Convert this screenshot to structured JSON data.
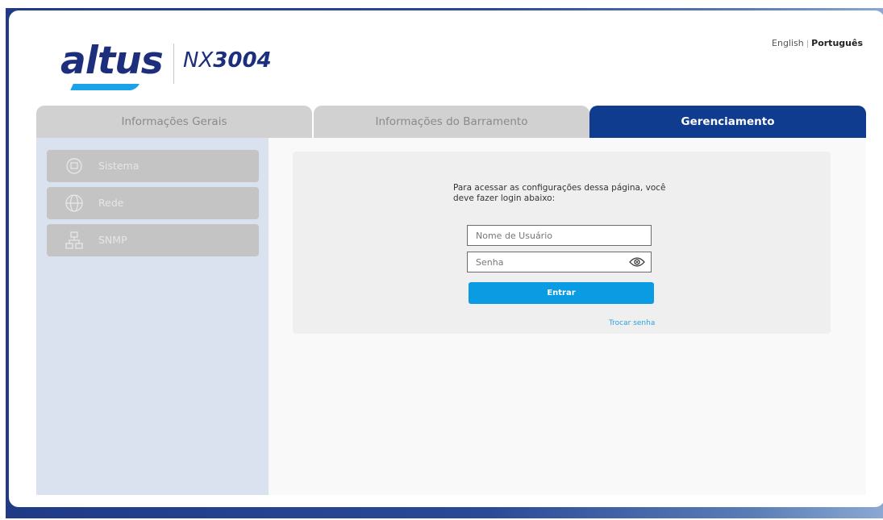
{
  "header": {
    "logo_text": "altus",
    "model_prefix": "NX",
    "model_number": "3004",
    "lang_english": "English",
    "lang_separator": "|",
    "lang_portuguese": "Português"
  },
  "tabs": [
    {
      "label": "Informações Gerais",
      "active": false
    },
    {
      "label": "Informações do Barramento",
      "active": false
    },
    {
      "label": "Gerenciamento",
      "active": true
    }
  ],
  "sidebar": {
    "items": [
      {
        "label": "Sistema",
        "icon": "system-icon"
      },
      {
        "label": "Rede",
        "icon": "globe-icon"
      },
      {
        "label": "SNMP",
        "icon": "network-icon"
      }
    ]
  },
  "login": {
    "message": "Para acessar as configurações dessa página, você deve fazer login abaixo:",
    "username_placeholder": "Nome de Usuário",
    "password_placeholder": "Senha",
    "submit_label": "Entrar",
    "change_password_label": "Trocar senha"
  },
  "colors": {
    "active_tab": "#0f3c8f",
    "button": "#0b9be3",
    "sidebar_bg": "#dbe2ef",
    "logo": "#1d2f7c"
  }
}
